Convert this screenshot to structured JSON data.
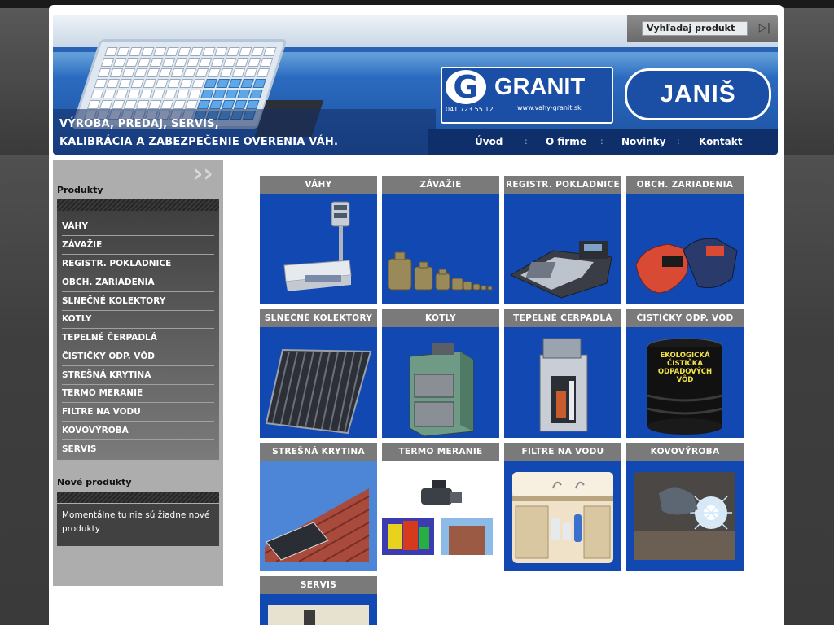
{
  "search": {
    "label": "Vyhľadaj produkt",
    "go_icon": "play-arrow-icon"
  },
  "header": {
    "tagline": [
      "VÝROBA, PREDAJ, SERVIS,",
      "KALIBRÁCIA A ZABEZPEČENIE OVERENIA VÁH."
    ],
    "granit_logo": {
      "word": "GRANIT",
      "letter": "G",
      "phone": "041 723 55 12",
      "url": "www.vahy-granit.sk"
    },
    "janis_logo": {
      "word": "JANIŠ"
    }
  },
  "nav": {
    "items": [
      "Úvod",
      "O firme",
      "Novinky",
      "Kontakt"
    ],
    "separator": ":"
  },
  "sidebar": {
    "products_title": "Produkty",
    "menu": [
      "VÁHY",
      "ZÁVAŽIE",
      "REGISTR. POKLADNICE",
      "OBCH. ZARIADENIA",
      "SLNEČNÉ KOLEKTORY",
      "KOTLY",
      "TEPELNÉ ČERPADLÁ",
      "ČISTIČKY ODP. VÔD",
      "STREŠNÁ KRYTINA",
      "TERMO MERANIE",
      "FILTRE NA VODU",
      "KOVOVÝROBA",
      "SERVIS"
    ],
    "new_title": "Nové produkty",
    "new_text": "Momentálne tu nie sú žiadne nové produkty"
  },
  "tiles": [
    {
      "label": "VÁHY"
    },
    {
      "label": "ZÁVAŽIE"
    },
    {
      "label": "REGISTR. POKLADNICE"
    },
    {
      "label": "OBCH. ZARIADENIA"
    },
    {
      "label": "SLNEČNÉ KOLEKTORY"
    },
    {
      "label": "KOTLY"
    },
    {
      "label": "TEPELNÉ ČERPADLÁ"
    },
    {
      "label": "ČISTIČKY ODP. VÔD",
      "image_text": [
        "EKOLOGICKÁ",
        "ČISTIČKA",
        "ODPADOVÝCH",
        "VÔD"
      ]
    },
    {
      "label": "STREŠNÁ KRYTINA"
    },
    {
      "label": "TERMO MERANIE"
    },
    {
      "label": "FILTRE NA VODU"
    },
    {
      "label": "KOVOVÝROBA"
    },
    {
      "label": "SERVIS"
    }
  ],
  "colors": {
    "tile_blue": "#1148b2",
    "tile_label": "#7a7a7a",
    "nav_bg": "#0e2f6a",
    "menu_dark": "#404040"
  }
}
